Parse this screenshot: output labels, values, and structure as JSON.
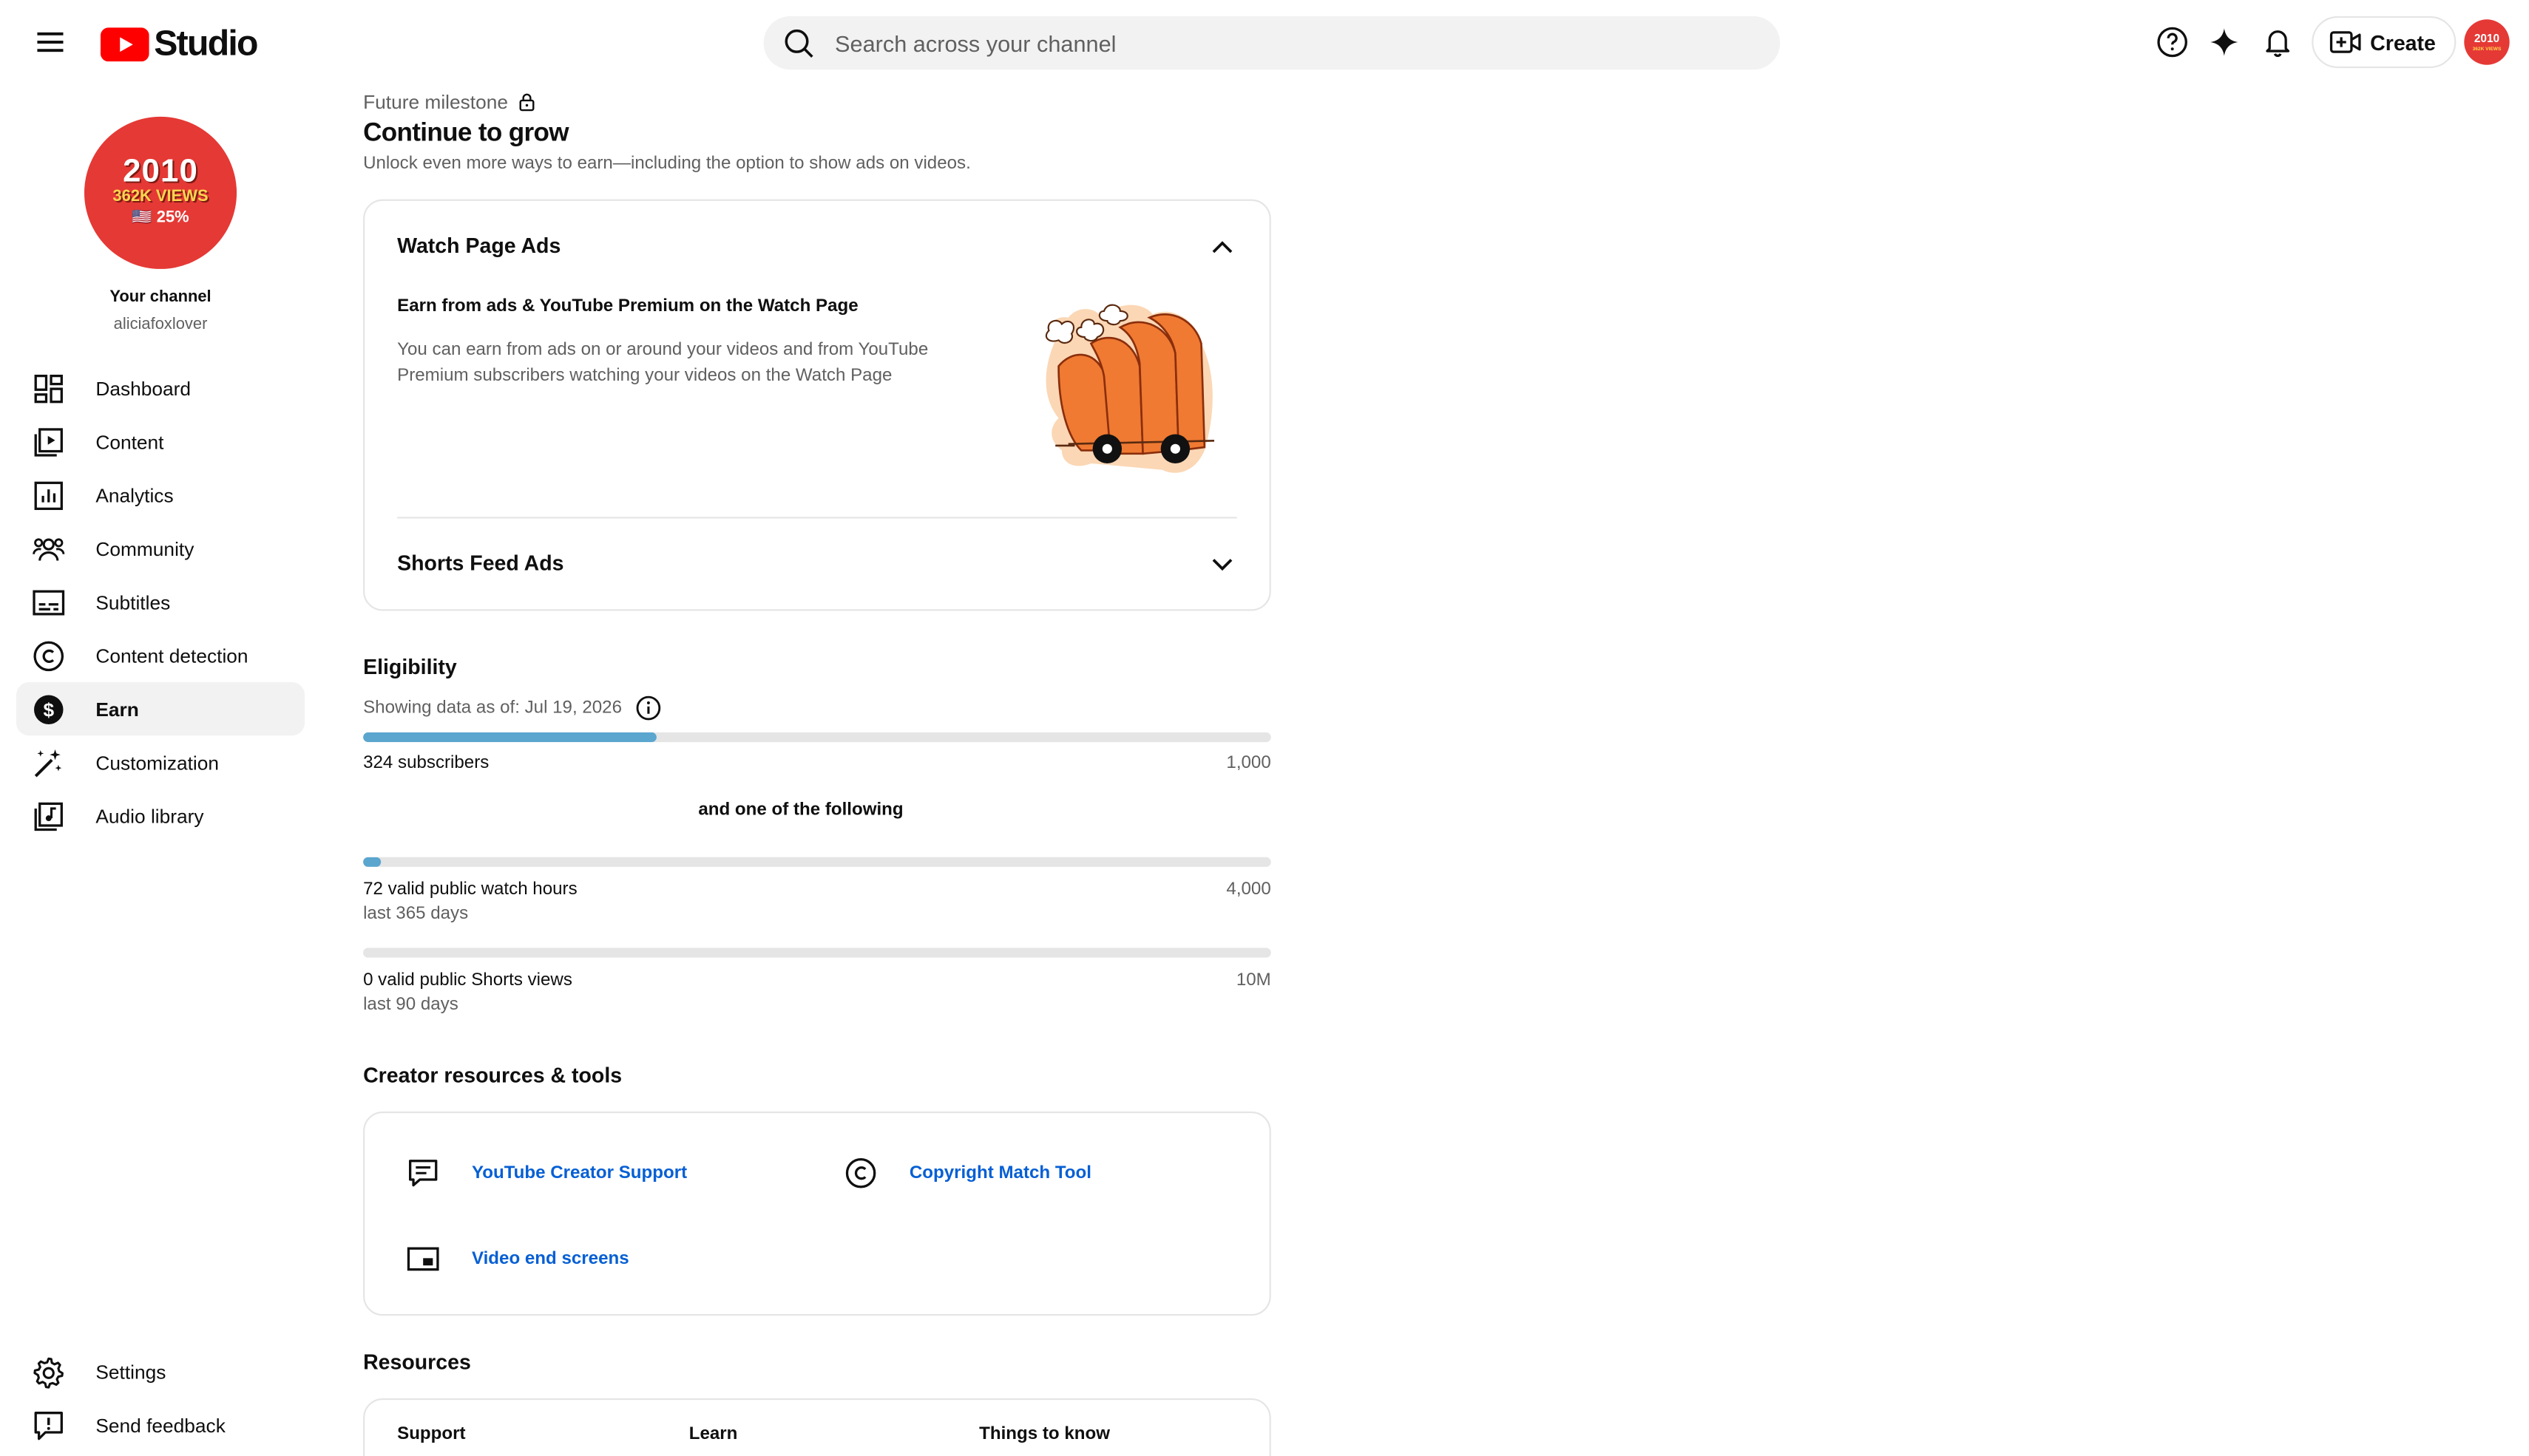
{
  "header": {
    "logo_text": "Studio",
    "search_placeholder": "Search across your channel",
    "create_label": "Create",
    "avatar_text_1": "2010",
    "avatar_text_2": "362K VIEWS"
  },
  "sidebar": {
    "avatar": {
      "line1": "2010",
      "line2": "362K VIEWS",
      "line3": "🇺🇸 25%"
    },
    "channel_label": "Your channel",
    "channel_handle": "aliciafoxlover",
    "items": [
      {
        "label": "Dashboard",
        "icon": "dashboard-icon"
      },
      {
        "label": "Content",
        "icon": "content-icon"
      },
      {
        "label": "Analytics",
        "icon": "analytics-icon"
      },
      {
        "label": "Community",
        "icon": "community-icon"
      },
      {
        "label": "Subtitles",
        "icon": "subtitles-icon"
      },
      {
        "label": "Content detection",
        "icon": "copyright-icon"
      },
      {
        "label": "Earn",
        "icon": "dollar-icon",
        "active": true
      },
      {
        "label": "Customization",
        "icon": "magic-wand-icon"
      },
      {
        "label": "Audio library",
        "icon": "audio-library-icon"
      }
    ],
    "bottom_items": [
      {
        "label": "Settings",
        "icon": "gear-icon"
      },
      {
        "label": "Send feedback",
        "icon": "feedback-icon"
      }
    ]
  },
  "milestone": {
    "label": "Future milestone",
    "title": "Continue to grow",
    "description": "Unlock even more ways to earn—including the option to show ads on videos."
  },
  "ads_card": {
    "watch_title": "Watch Page Ads",
    "watch_subtitle": "Earn from ads & YouTube Premium on the Watch Page",
    "watch_body": "You can earn from ads on or around your videos and from YouTube Premium subscribers watching your videos on the Watch Page",
    "shorts_title": "Shorts Feed Ads"
  },
  "eligibility": {
    "title": "Eligibility",
    "as_of": "Showing data as of: Jul 19, 2026",
    "subscribers": {
      "label": "324 subscribers",
      "target": "1,000",
      "progress": 0.324
    },
    "and_one": "and one of the following",
    "watch_hours": {
      "label": "72 valid public watch hours",
      "sub": "last 365 days",
      "target": "4,000",
      "progress": 0.018
    },
    "shorts_views": {
      "label": "0 valid public Shorts views",
      "sub": "last 90 days",
      "target": "10M",
      "progress": 0
    }
  },
  "tools": {
    "title": "Creator resources & tools",
    "support": "YouTube Creator Support",
    "copyright": "Copyright Match Tool",
    "endscreens": "Video end screens"
  },
  "resources": {
    "title": "Resources",
    "cols": [
      "Support",
      "Learn",
      "Things to know"
    ]
  },
  "colors": {
    "progress": "#5aa6cf",
    "link": "#065fd4",
    "brand_red": "#ff0000"
  }
}
